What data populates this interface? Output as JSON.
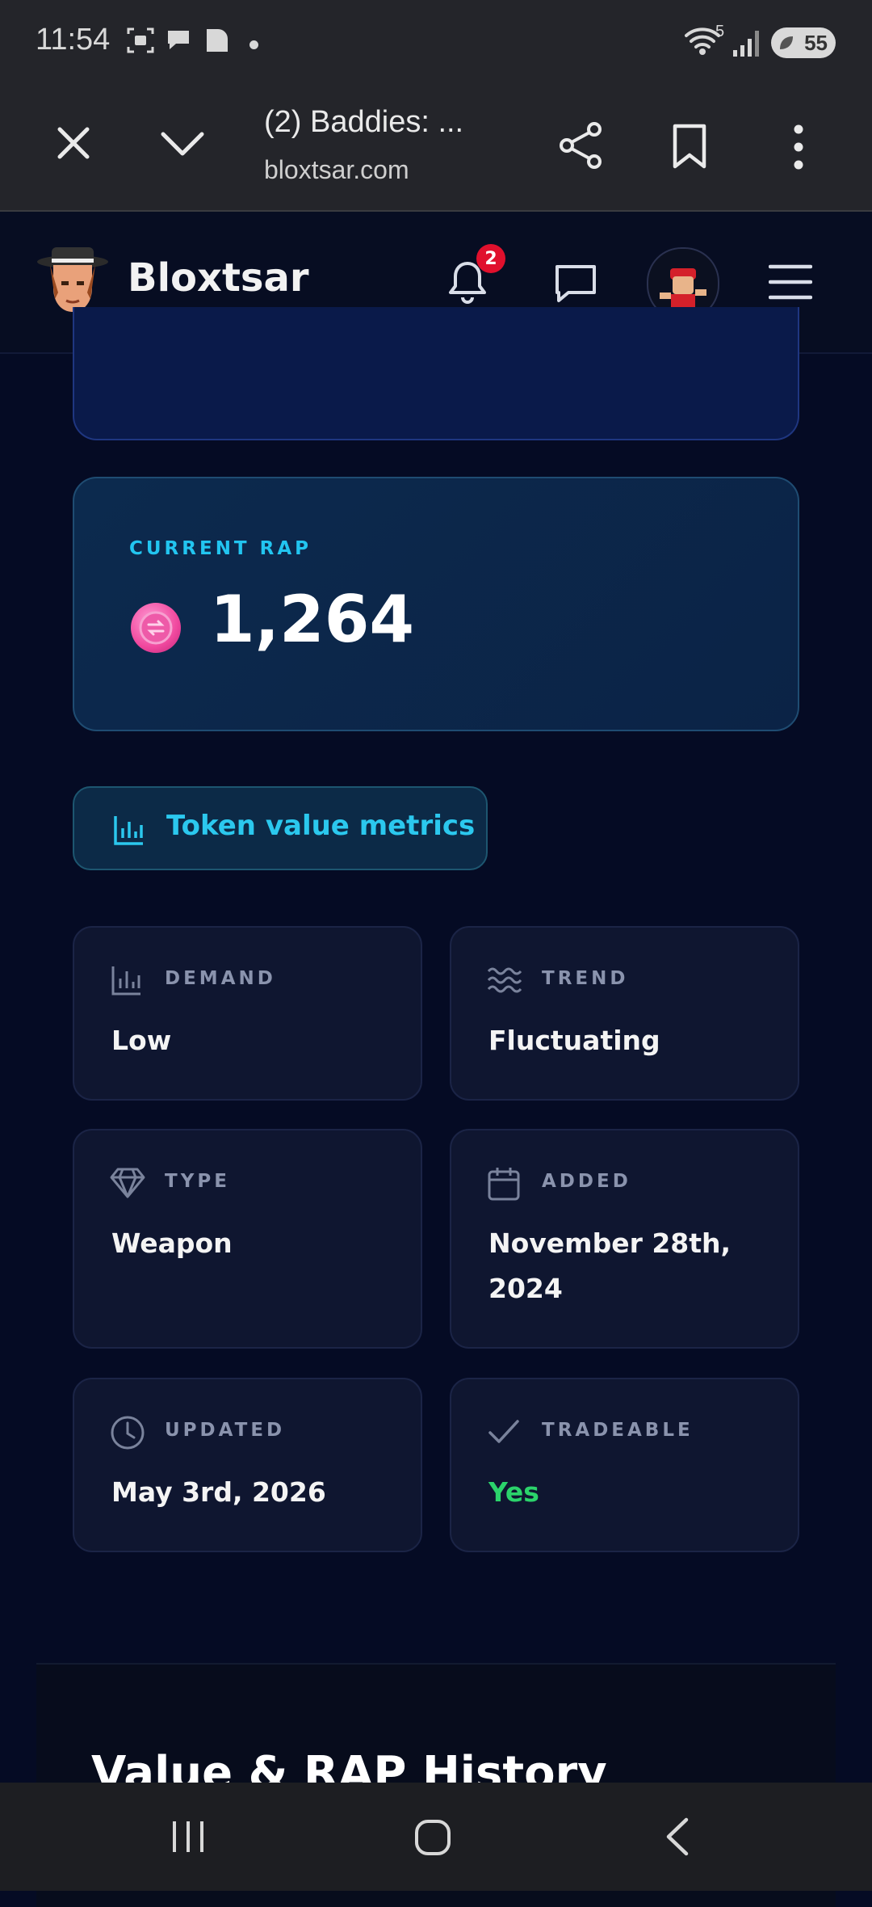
{
  "status_bar": {
    "time": "11:54",
    "network": "5",
    "battery": "55"
  },
  "browser": {
    "tab_title": "(2) Baddies: ...",
    "url": "bloxtsar.com"
  },
  "site": {
    "brand": "Bloxtsar",
    "notification_count": "2"
  },
  "rap_card": {
    "label": "CURRENT RAP",
    "value": "1,264"
  },
  "metrics_button": {
    "label": "Token value metrics"
  },
  "metrics": [
    {
      "label": "DEMAND",
      "value": "Low",
      "icon": "bar-chart-icon"
    },
    {
      "label": "TREND",
      "value": "Fluctuating",
      "icon": "waves-icon"
    },
    {
      "label": "TYPE",
      "value": "Weapon",
      "icon": "diamond-icon"
    },
    {
      "label": "ADDED",
      "value": "November 28th, 2024",
      "icon": "calendar-icon"
    },
    {
      "label": "UPDATED",
      "value": "May 3rd, 2026",
      "icon": "clock-icon"
    },
    {
      "label": "TRADEABLE",
      "value": "Yes",
      "icon": "check-icon"
    }
  ],
  "colors": {
    "accent": "#22c5f0",
    "tradeable_yes": "#2bd36b",
    "coin": "#f0489e"
  },
  "section": {
    "heading": "Value & RAP History"
  }
}
